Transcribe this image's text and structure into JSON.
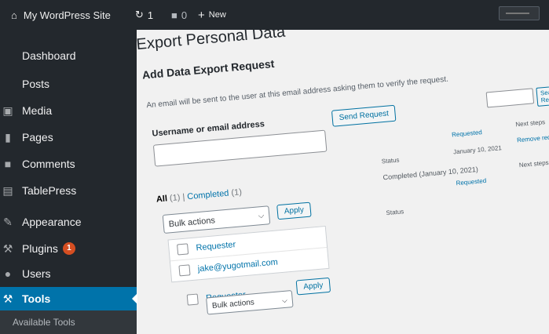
{
  "adminbar": {
    "site_name": "My WordPress Site",
    "updates_count": "1",
    "comments_count": "0",
    "new_label": "New"
  },
  "sidebar": {
    "items": [
      {
        "label": "Dashboard",
        "icon": "dashboard-icon"
      },
      {
        "label": "Posts",
        "icon": "pin-icon"
      },
      {
        "label": "Media",
        "icon": "media-icon"
      },
      {
        "label": "Pages",
        "icon": "page-icon"
      },
      {
        "label": "Comments",
        "icon": "comment-icon"
      },
      {
        "label": "TablePress",
        "icon": "table-icon"
      },
      {
        "label": "Appearance",
        "icon": "brush-icon"
      },
      {
        "label": "Plugins",
        "icon": "plugin-icon",
        "badge": "1"
      },
      {
        "label": "Users",
        "icon": "user-icon"
      },
      {
        "label": "Tools",
        "icon": "wrench-icon",
        "active": true
      }
    ],
    "submenu_first": "Available Tools"
  },
  "main": {
    "page_title": "Export Personal Data",
    "section_title": "Add Data Export Request",
    "description": "An email will be sent to the user at this email address asking them to verify the request.",
    "field_label": "Username or email address",
    "send_button": "Send Request",
    "filter": {
      "all": "All",
      "all_count": "(1)",
      "separator": "|",
      "completed": "Completed",
      "completed_count": "(1)"
    },
    "bulk_actions": "Bulk actions",
    "apply": "Apply",
    "table": {
      "header_requester": "Requester",
      "row_email": "jake@yugotmail.com",
      "header_status": "Status",
      "status_value": "Completed (January 10, 2021)",
      "requested_label": "Requested",
      "requested_date": "January 10, 2021",
      "next_steps": "Next steps",
      "remove_request": "Remove request",
      "search_button": "Search Requests"
    },
    "footer_requester": "Requester"
  },
  "colors": {
    "adminbar_bg": "#23282d",
    "sidebar_bg": "#23282d",
    "active_bg": "#0073aa",
    "link": "#0073aa",
    "badge": "#d54e21",
    "content_bg": "#f1f1f1"
  }
}
